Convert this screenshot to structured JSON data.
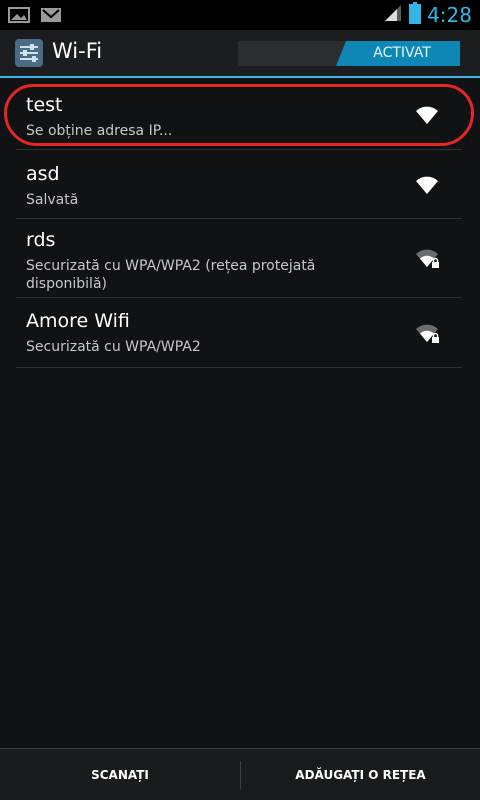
{
  "status_bar": {
    "time": "4:28",
    "left_icons": [
      "image-icon",
      "gmail-icon"
    ],
    "right_icons": [
      "signal-icon",
      "battery-icon"
    ]
  },
  "action_bar": {
    "title": "Wi-Fi",
    "icon": "settings-sliders-icon",
    "toggle_label": "ACTIVAT",
    "toggle_state": "on"
  },
  "networks": [
    {
      "ssid": "test",
      "status": "Se obține adresa IP...",
      "signal": "strong",
      "secured": false
    },
    {
      "ssid": "asd",
      "status": "Salvată",
      "signal": "strong",
      "secured": false
    },
    {
      "ssid": "rds",
      "status": "Securizată cu WPA/WPA2 (rețea protejată disponibilă)",
      "signal": "medium",
      "secured": true
    },
    {
      "ssid": "Amore Wifi",
      "status": "Securizată cu WPA/WPA2",
      "signal": "medium",
      "secured": true
    }
  ],
  "footer": {
    "scan_label": "SCANAȚI",
    "add_label": "ADĂUGAȚI O REȚEA"
  },
  "colors": {
    "accent": "#33b5e5",
    "highlight": "#e52626",
    "background": "#101214"
  }
}
